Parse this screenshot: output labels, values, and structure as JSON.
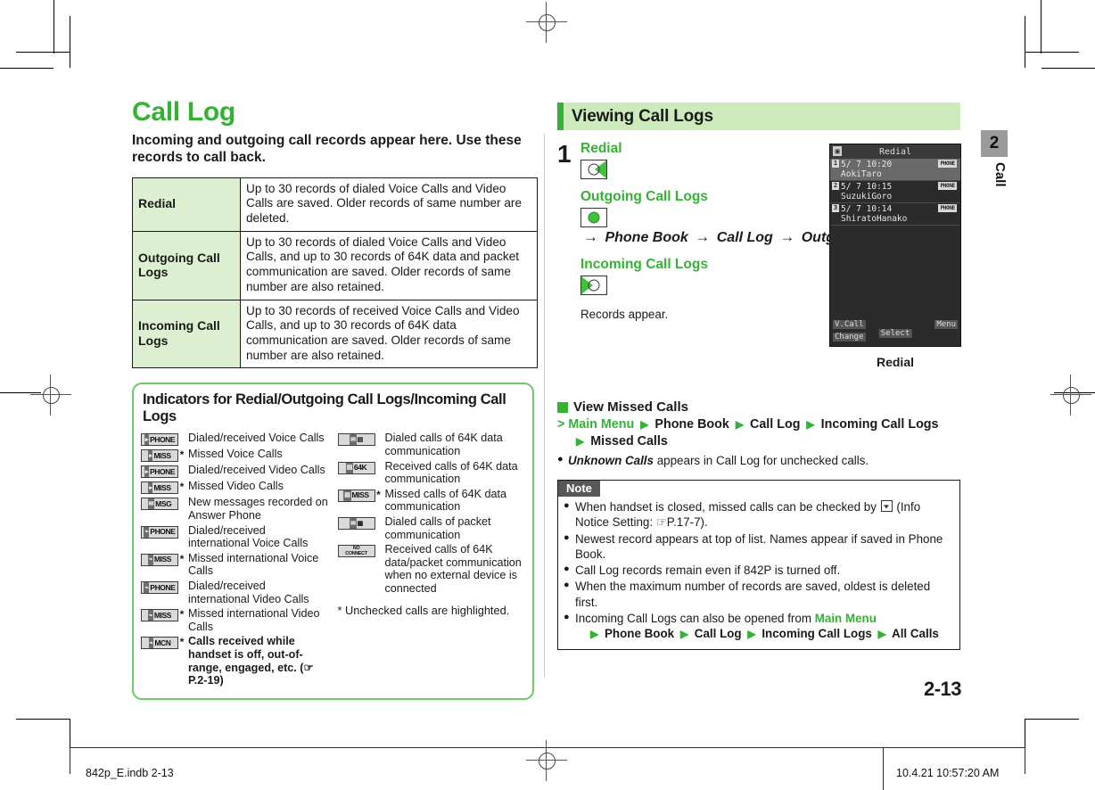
{
  "document": {
    "title": "Call Log",
    "lede": "Incoming and outgoing call records appear here. Use these records to call back.",
    "page_number": "2-13",
    "tab_number": "2",
    "tab_label": "Call"
  },
  "spec_table": {
    "rows": [
      {
        "term": "Redial",
        "description": "Up to 30 records of dialed Voice Calls and Video Calls are saved. Older records of same number are deleted."
      },
      {
        "term": "Outgoing Call Logs",
        "description": "Up to 30 records of dialed Voice Calls and Video Calls, and up to 30 records of 64K data and packet communication are saved. Older records of same number are also retained."
      },
      {
        "term": "Incoming Call Logs",
        "description": "Up to 30 records of received Voice Calls and Video Calls, and up to 30 records of 64K data communication are saved. Older records of same number are also retained."
      }
    ]
  },
  "indicators": {
    "heading": "Indicators for Redial/Outgoing Call Logs/Incoming Call Logs",
    "left_column": [
      {
        "icon": "PHONE",
        "icon_name": "voice-call-indicator-icon",
        "star": false,
        "text": "Dialed/received Voice Calls"
      },
      {
        "icon": "MISS",
        "icon_name": "missed-voice-call-indicator-icon",
        "star": true,
        "text": "Missed Voice Calls"
      },
      {
        "icon": "PHONE",
        "icon_name": "video-call-indicator-icon",
        "star": false,
        "text": "Dialed/received Video Calls"
      },
      {
        "icon": "MISS",
        "icon_name": "missed-video-call-indicator-icon",
        "star": true,
        "text": "Missed Video Calls"
      },
      {
        "icon": "MSG",
        "icon_name": "answer-phone-message-indicator-icon",
        "star": false,
        "text": "New messages recorded on Answer Phone"
      },
      {
        "icon": "PHONE",
        "icon_name": "international-voice-call-indicator-icon",
        "star": false,
        "text": "Dialed/received international Voice Calls"
      },
      {
        "icon": "MISS",
        "icon_name": "missed-international-voice-call-indicator-icon",
        "star": true,
        "text": "Missed international Voice Calls"
      },
      {
        "icon": "PHONE",
        "icon_name": "international-video-call-indicator-icon",
        "star": false,
        "text": "Dialed/received international Video Calls"
      },
      {
        "icon": "MISS",
        "icon_name": "missed-international-video-call-indicator-icon",
        "star": true,
        "text": "Missed international Video Calls"
      },
      {
        "icon": "MCN",
        "icon_name": "missed-call-notification-indicator-icon",
        "star": true,
        "text": "Calls received while handset is off, out-of-range, engaged, etc. (☞P.2-19)",
        "bold": true
      }
    ],
    "right_column": [
      {
        "icon": "64K",
        "icon_name": "dialed-64k-data-indicator-icon",
        "star": false,
        "text": "Dialed calls of 64K data communication"
      },
      {
        "icon": "64K",
        "icon_name": "received-64k-data-indicator-icon",
        "star": false,
        "text": "Received calls of 64K data communication"
      },
      {
        "icon": "MISS",
        "icon_name": "missed-64k-data-indicator-icon",
        "star": true,
        "text": "Missed calls of 64K data communication"
      },
      {
        "icon": "PKT",
        "icon_name": "dialed-packet-indicator-icon",
        "star": false,
        "text": "Dialed calls of packet communication"
      },
      {
        "icon": "NO CONNECT",
        "icon_name": "no-connect-indicator-icon",
        "star": false,
        "text": "Received calls of 64K data/packet communication when no external device is connected"
      }
    ],
    "footnote": "* Unchecked calls are highlighted."
  },
  "viewing_section": {
    "heading": "Viewing Call Logs",
    "step_number": "1",
    "substeps": [
      {
        "label": "Redial",
        "key_icon": "right-soft-key-icon",
        "nav": ""
      },
      {
        "label": "Outgoing Call Logs",
        "key_icon": "center-key-icon",
        "nav_parts": [
          "Phone Book",
          "Call Log",
          "Outgoing Call Logs"
        ]
      },
      {
        "label": "Incoming Call Logs",
        "key_icon": "left-soft-key-icon",
        "nav": ""
      }
    ],
    "result_text": "Records appear.",
    "screenshot_caption": "Redial"
  },
  "phone_screen": {
    "title": "Redial",
    "rows": [
      {
        "index": "1",
        "time": "5/ 7 10:20",
        "name": "AokiTaro",
        "badge": "PHONE",
        "selected": true
      },
      {
        "index": "2",
        "time": "5/ 7 10:15",
        "name": "SuzukiGoro",
        "badge": "PHONE",
        "selected": false
      },
      {
        "index": "3",
        "time": "5/ 7 10:14",
        "name": "ShiratoHanako",
        "badge": "PHONE",
        "selected": false
      }
    ],
    "softkeys": {
      "left_top": "V.Call",
      "left_bottom": "Change",
      "center": "Select",
      "right": "Menu"
    }
  },
  "view_missed_calls": {
    "heading": "View Missed Calls",
    "path_prefix": ">",
    "path": [
      "Main Menu",
      "Phone Book",
      "Call Log",
      "Incoming Call Logs",
      "Missed Calls"
    ],
    "bullet": {
      "emphasis": "Unknown Calls",
      "rest": " appears in Call Log for unchecked calls."
    }
  },
  "note": {
    "label": "Note",
    "items": [
      {
        "pre": "When handset is closed, missed calls can be checked by ",
        "key": true,
        "post": " (Info Notice Setting: ☞P.17-7)."
      },
      {
        "pre": "Newest record appears at top of list. Names appear if saved in Phone Book.",
        "key": false,
        "post": ""
      },
      {
        "pre": "Call Log records remain even if 842P is turned off.",
        "key": false,
        "post": ""
      },
      {
        "pre": "When the maximum number of records are saved, oldest is deleted first.",
        "key": false,
        "post": ""
      },
      {
        "pre": "Incoming Call Logs can also be opened from ",
        "key": false,
        "post": "",
        "green": "Main Menu",
        "path": [
          "Phone Book",
          "Call Log",
          "Incoming Call Logs",
          "All Calls"
        ]
      }
    ]
  },
  "footer": {
    "left": "842p_E.indb   2-13",
    "right": "10.4.21   10:57:20 AM"
  },
  "colors": {
    "brand_green": "#35b234",
    "cell_green": "#dcefd0",
    "bar_green": "#cdeabc",
    "box_border_green": "#6ec96a",
    "tab_gray": "#9b9b9b"
  }
}
